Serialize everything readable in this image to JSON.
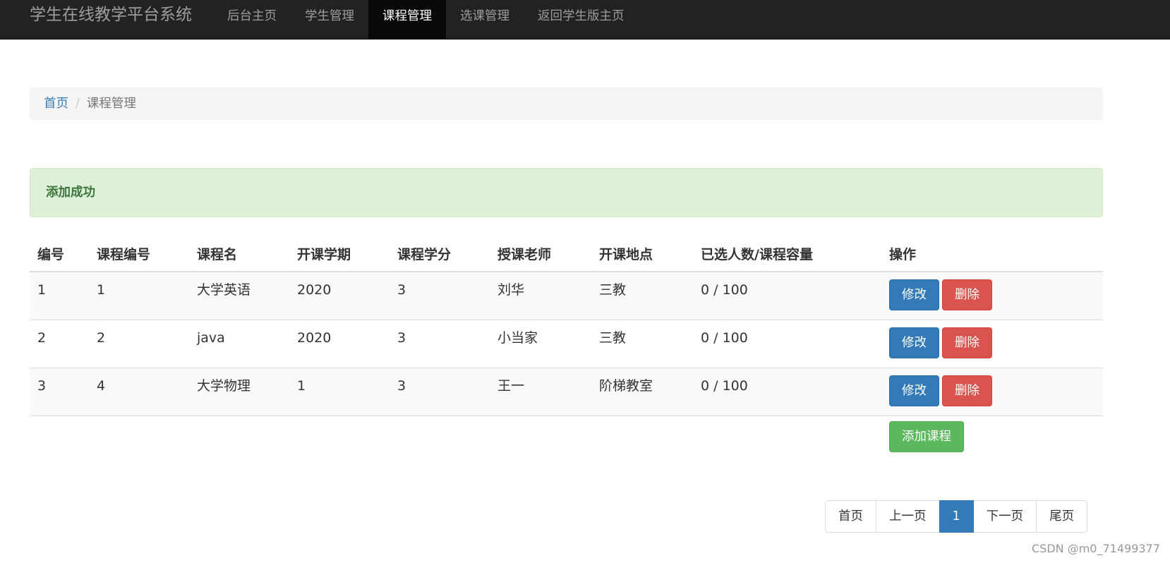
{
  "navbar": {
    "brand": "学生在线教学平台系统",
    "items": [
      {
        "label": "后台主页"
      },
      {
        "label": "学生管理"
      },
      {
        "label": "课程管理"
      },
      {
        "label": "选课管理"
      },
      {
        "label": "返回学生版主页"
      }
    ]
  },
  "breadcrumb": {
    "home": "首页",
    "separator": "/",
    "current": "课程管理"
  },
  "alert": {
    "message": "添加成功",
    "color": "#3c763d",
    "background": "#dff0d8"
  },
  "table": {
    "headers": [
      "编号",
      "课程编号",
      "课程名",
      "开课学期",
      "课程学分",
      "授课老师",
      "开课地点",
      "已选人数/课程容量",
      "操作"
    ],
    "rows": [
      [
        "1",
        "1",
        "大学英语",
        "2020",
        "3",
        "刘华",
        "三教",
        "0 / 100"
      ],
      [
        "2",
        "2",
        "java",
        "2020",
        "3",
        "小当家",
        "三教",
        "0 / 100"
      ],
      [
        "3",
        "4",
        "大学物理",
        "1",
        "3",
        "王一",
        "阶梯教室",
        "0 / 100"
      ]
    ],
    "edit_label": "修改",
    "delete_label": "删除",
    "add_label": "添加课程"
  },
  "pagination": {
    "first": "首页",
    "prev": "上一页",
    "current": "1",
    "next": "下一页",
    "last": "尾页"
  },
  "watermark": "CSDN @m0_71499377",
  "colors": {
    "navbar": "#222222",
    "primary": "#337ab7",
    "danger": "#d9534f",
    "success": "#5cb85c"
  }
}
